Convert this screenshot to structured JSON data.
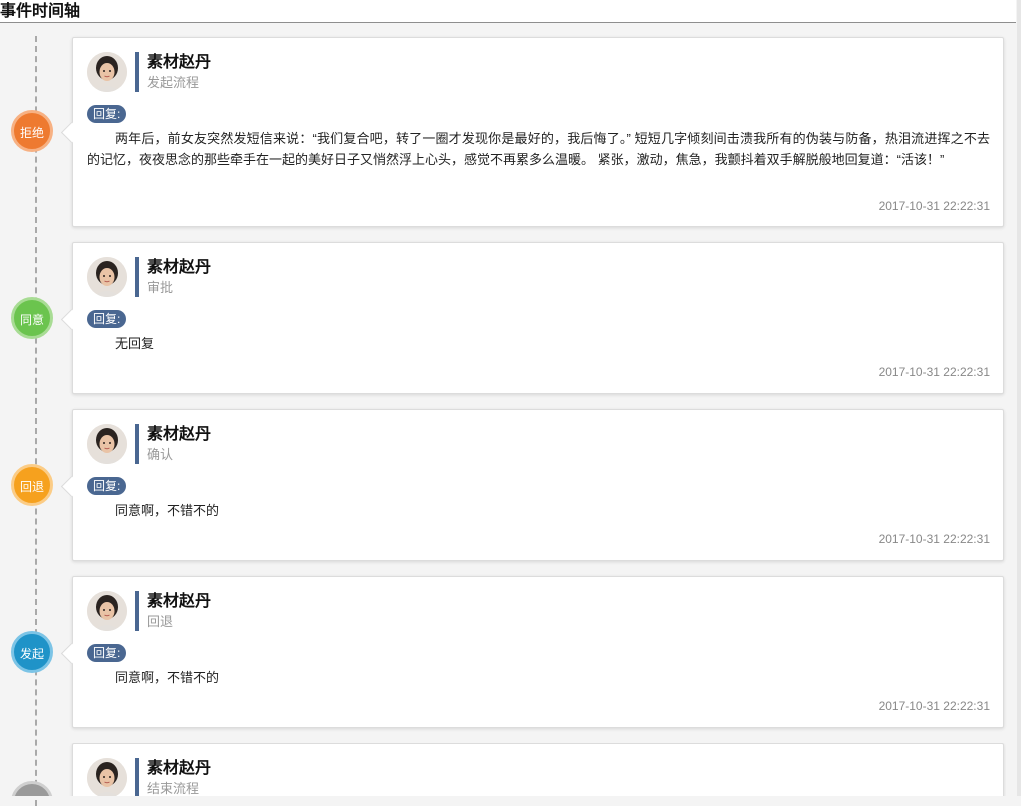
{
  "page": {
    "title": "事件时间轴"
  },
  "colors": {
    "reject": "#ee7a30",
    "agree": "#6bc44e",
    "return": "#f6a11e",
    "initiate": "#1f93c8",
    "end": "#9a9a9a",
    "badge": "#4a6791"
  },
  "events": [
    {
      "status": "拒绝",
      "name": "素材赵丹",
      "action": "发起流程",
      "reply_label": "回复:",
      "reply": "两年后，前女友突然发短信来说：“我们复合吧，转了一圈才发现你是最好的，我后悔了。” 短短几字倾刻间击溃我所有的伪装与防备，热泪流进挥之不去的记忆，夜夜思念的那些牵手在一起的美好日子又悄然浮上心头，感觉不再累多么温暖。 紧张，激动，焦急，我颤抖着双手解脱般地回复道：“活该！”",
      "time": "2017-10-31 22:22:31"
    },
    {
      "status": "同意",
      "name": "素材赵丹",
      "action": "审批",
      "reply_label": "回复:",
      "reply": "无回复",
      "time": "2017-10-31 22:22:31"
    },
    {
      "status": "回退",
      "name": "素材赵丹",
      "action": "确认",
      "reply_label": "回复:",
      "reply": "同意啊，不错不的",
      "time": "2017-10-31 22:22:31"
    },
    {
      "status": "发起",
      "name": "素材赵丹",
      "action": "回退",
      "reply_label": "回复:",
      "reply": "同意啊，不错不的",
      "time": "2017-10-31 22:22:31"
    },
    {
      "status": "",
      "name": "素材赵丹",
      "action": "结束流程",
      "reply_label": "",
      "reply": "",
      "time": ""
    }
  ]
}
